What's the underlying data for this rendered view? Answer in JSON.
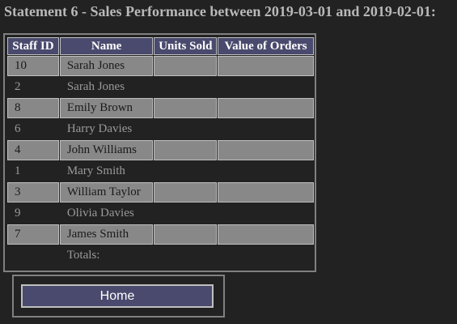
{
  "page": {
    "heading": "Statement 6 - Sales Performance between 2019-03-01 and 2019-02-01:"
  },
  "table": {
    "headers": [
      "Staff ID",
      "Name",
      "Units Sold",
      "Value of Orders"
    ],
    "rows": [
      {
        "staff_id": "10",
        "name": "Sarah Jones",
        "units_sold": "",
        "value_of_orders": ""
      },
      {
        "staff_id": "2",
        "name": "Sarah Jones",
        "units_sold": "",
        "value_of_orders": ""
      },
      {
        "staff_id": "8",
        "name": "Emily Brown",
        "units_sold": "",
        "value_of_orders": ""
      },
      {
        "staff_id": "6",
        "name": "Harry Davies",
        "units_sold": "",
        "value_of_orders": ""
      },
      {
        "staff_id": "4",
        "name": "John Williams",
        "units_sold": "",
        "value_of_orders": ""
      },
      {
        "staff_id": "1",
        "name": "Mary Smith",
        "units_sold": "",
        "value_of_orders": ""
      },
      {
        "staff_id": "3",
        "name": "William Taylor",
        "units_sold": "",
        "value_of_orders": ""
      },
      {
        "staff_id": "9",
        "name": "Olivia Davies",
        "units_sold": "",
        "value_of_orders": ""
      },
      {
        "staff_id": "7",
        "name": "James Smith",
        "units_sold": "",
        "value_of_orders": ""
      }
    ],
    "totals_label": "Totals:"
  },
  "navigation": {
    "home_label": "Home"
  },
  "colors": {
    "background": "#222222",
    "header_fill": "#4a4a6e",
    "odd_row_fill": "#888888",
    "border": "#808080"
  }
}
